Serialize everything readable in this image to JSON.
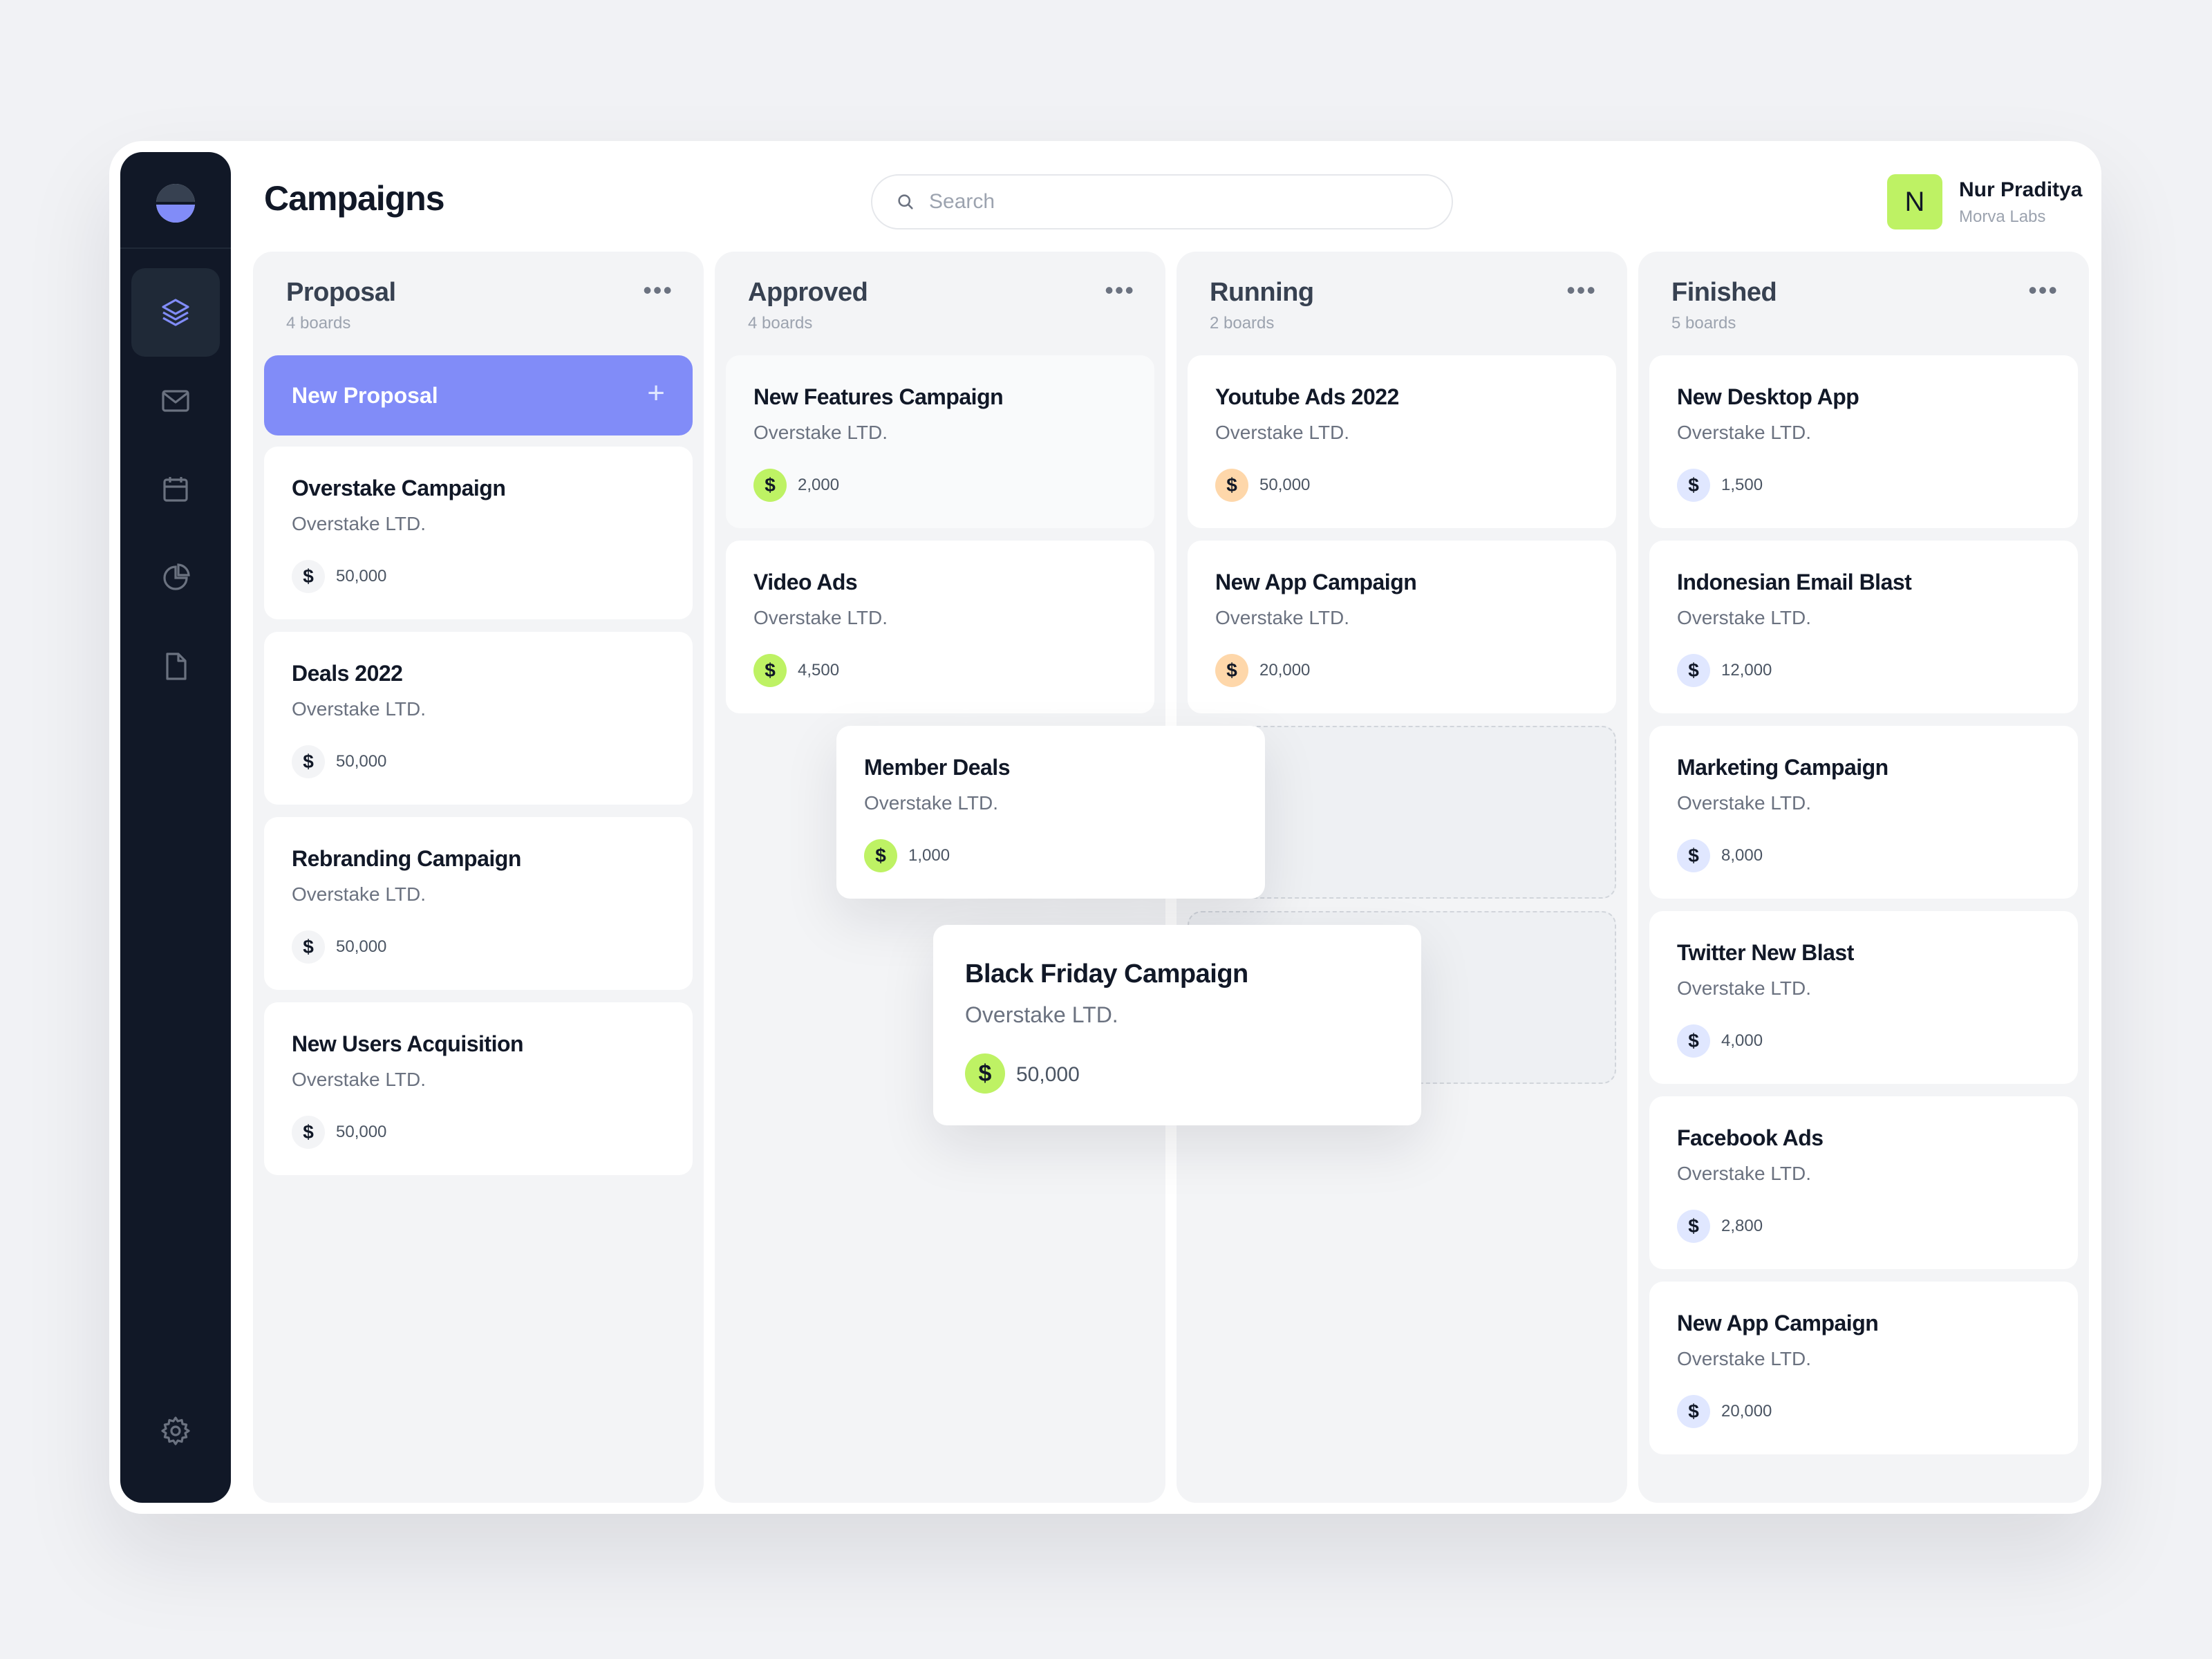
{
  "app": {
    "page_title": "Campaigns",
    "search_placeholder": "Search",
    "user": {
      "initial": "N",
      "name": "Nur Praditya",
      "org": "Morva Labs"
    }
  },
  "sidebar": {
    "items": [
      {
        "icon": "layers-icon",
        "active": true
      },
      {
        "icon": "mail-icon",
        "active": false
      },
      {
        "icon": "calendar-icon",
        "active": false
      },
      {
        "icon": "pie-chart-icon",
        "active": false
      },
      {
        "icon": "document-icon",
        "active": false
      },
      {
        "icon": "gear-icon",
        "active": false
      }
    ]
  },
  "columns": [
    {
      "title": "Proposal",
      "count": "4 boards",
      "add_label": "New Proposal",
      "add_icon": "+",
      "cards": [
        {
          "title": "Overstake Campaign",
          "company": "Overstake LTD.",
          "amount": "50,000",
          "coin": "$"
        },
        {
          "title": "Deals 2022",
          "company": "Overstake LTD.",
          "amount": "50,000",
          "coin": "$"
        },
        {
          "title": "Rebranding Campaign",
          "company": "Overstake LTD.",
          "amount": "50,000",
          "coin": "$"
        },
        {
          "title": "New Users Acquisition",
          "company": "Overstake LTD.",
          "amount": "50,000",
          "coin": "$"
        }
      ]
    },
    {
      "title": "Approved",
      "count": "4 boards",
      "cards": [
        {
          "title": "New Features Campaign",
          "company": "Overstake LTD.",
          "amount": "2,000",
          "coin": "$"
        },
        {
          "title": "Video Ads",
          "company": "Overstake LTD.",
          "amount": "4,500",
          "coin": "$"
        }
      ]
    },
    {
      "title": "Running",
      "count": "2 boards",
      "cards": [
        {
          "title": "Youtube Ads 2022",
          "company": "Overstake LTD.",
          "amount": "50,000",
          "coin": "$"
        },
        {
          "title": "New App Campaign",
          "company": "Overstake LTD.",
          "amount": "20,000",
          "coin": "$"
        }
      ]
    },
    {
      "title": "Finished",
      "count": "5 boards",
      "cards": [
        {
          "title": "New Desktop App",
          "company": "Overstake LTD.",
          "amount": "1,500",
          "coin": "$"
        },
        {
          "title": "Indonesian Email Blast",
          "company": "Overstake LTD.",
          "amount": "12,000",
          "coin": "$"
        },
        {
          "title": "Marketing Campaign",
          "company": "Overstake LTD.",
          "amount": "8,000",
          "coin": "$"
        },
        {
          "title": "Twitter New Blast",
          "company": "Overstake LTD.",
          "amount": "4,000",
          "coin": "$"
        },
        {
          "title": "Facebook Ads",
          "company": "Overstake LTD.",
          "amount": "2,800",
          "coin": "$"
        },
        {
          "title": "New App Campaign",
          "company": "Overstake LTD.",
          "amount": "20,000",
          "coin": "$"
        }
      ]
    }
  ],
  "dragging": [
    {
      "title": "Member Deals",
      "company": "Overstake LTD.",
      "amount": "1,000",
      "coin": "$"
    },
    {
      "title": "Black Friday Campaign",
      "company": "Overstake LTD.",
      "amount": "50,000",
      "coin": "$"
    }
  ],
  "colors": {
    "accent": "#818cf8",
    "sidebar": "#111827",
    "coin_green": "#bef264",
    "coin_orange": "#fed7aa",
    "coin_blue": "#e0e7ff",
    "coin_gray": "#f3f4f6"
  }
}
